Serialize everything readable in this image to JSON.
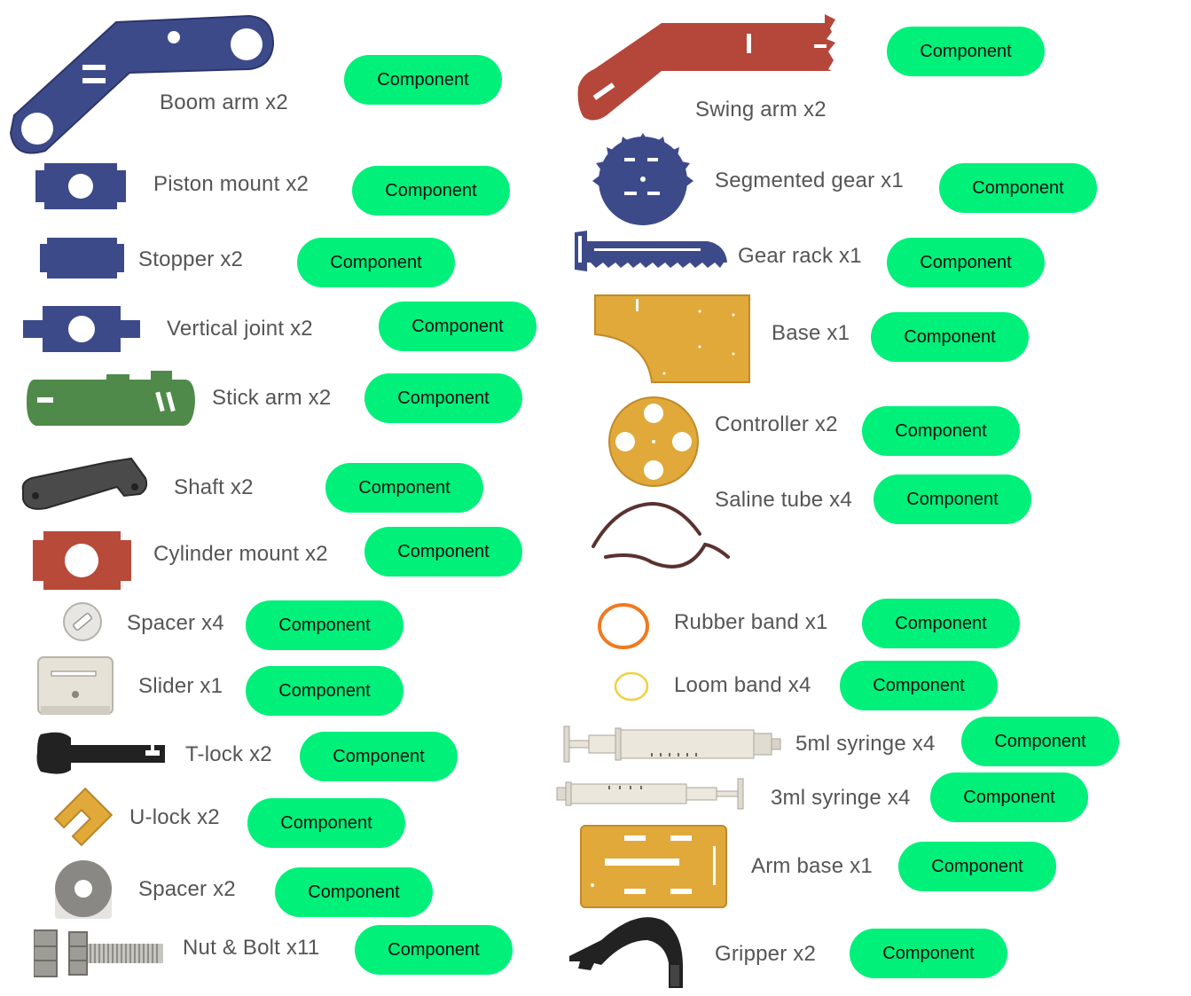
{
  "button_color": "#00f07a",
  "parts": [
    {
      "id": "boom-arm",
      "label": "Boom arm  x2",
      "button": "Component",
      "icon": "boom-arm-icon",
      "color": "#3d4a8a"
    },
    {
      "id": "piston-mount",
      "label": "Piston mount  x2",
      "button": "Component",
      "icon": "piston-mount-icon",
      "color": "#3d4a8a"
    },
    {
      "id": "stopper",
      "label": "Stopper  x2",
      "button": "Component",
      "icon": "stopper-icon",
      "color": "#3d4a8a"
    },
    {
      "id": "vertical-joint",
      "label": "Vertical joint  x2",
      "button": "Component",
      "icon": "vertical-joint-icon",
      "color": "#3d4a8a"
    },
    {
      "id": "stick-arm",
      "label": "Stick arm x2",
      "button": "Component",
      "icon": "stick-arm-icon",
      "color": "#4f8a4a"
    },
    {
      "id": "shaft",
      "label": "Shaft x2",
      "button": "Component",
      "icon": "shaft-icon",
      "color": "#4a4a4a"
    },
    {
      "id": "cylinder-mount",
      "label": "Cylinder mount  x2",
      "button": "Component",
      "icon": "cylinder-mount-icon",
      "color": "#b84a3a"
    },
    {
      "id": "spacer-small",
      "label": "Spacer x4",
      "button": "Component",
      "icon": "spacer-washer-icon",
      "color": "#e2e2e2"
    },
    {
      "id": "slider",
      "label": "Slider x1",
      "button": "Component",
      "icon": "slider-icon",
      "color": "#e6e2d8"
    },
    {
      "id": "t-lock",
      "label": "T-lock  x2",
      "button": "Component",
      "icon": "t-lock-icon",
      "color": "#222222"
    },
    {
      "id": "u-lock",
      "label": "U-lock  x2",
      "button": "Component",
      "icon": "u-lock-icon",
      "color": "#e0a93a"
    },
    {
      "id": "spacer-large",
      "label": "Spacer  x2",
      "button": "Component",
      "icon": "spacer-large-icon",
      "color": "#888888"
    },
    {
      "id": "nut-bolt",
      "label": "Nut & Bolt  x11",
      "button": "Component",
      "icon": "nut-bolt-icon",
      "color": "#999999"
    },
    {
      "id": "swing-arm",
      "label": "Swing arm  x2",
      "button": "Component",
      "icon": "swing-arm-icon",
      "color": "#b84a3a"
    },
    {
      "id": "segmented-gear",
      "label": "Segmented gear x1",
      "button": "Component",
      "icon": "segmented-gear-icon",
      "color": "#3d4a8a"
    },
    {
      "id": "gear-rack",
      "label": "Gear rack x1",
      "button": "Component",
      "icon": "gear-rack-icon",
      "color": "#3d4a8a"
    },
    {
      "id": "base",
      "label": "Base x1",
      "button": "Component",
      "icon": "base-plate-icon",
      "color": "#e0a93a"
    },
    {
      "id": "controller",
      "label": "Controller x2",
      "button": "Component",
      "icon": "controller-disc-icon",
      "color": "#e0a93a"
    },
    {
      "id": "saline-tube",
      "label": "Saline tube x4",
      "button": "Component",
      "icon": "saline-tube-icon",
      "color": "#5a3230"
    },
    {
      "id": "rubber-band",
      "label": "Rubber band x1",
      "button": "Component",
      "icon": "rubber-band-icon",
      "color": "#f07a20"
    },
    {
      "id": "loom-band",
      "label": "Loom band x4",
      "button": "Component",
      "icon": "loom-band-icon",
      "color": "#f2d040"
    },
    {
      "id": "syringe-5ml",
      "label": "5ml syringe x4",
      "button": "Component",
      "icon": "syringe-5ml-icon",
      "color": "#e8e4da"
    },
    {
      "id": "syringe-3ml",
      "label": "3ml syringe x4",
      "button": "Component",
      "icon": "syringe-3ml-icon",
      "color": "#e8e4da"
    },
    {
      "id": "arm-base",
      "label": "Arm base x1",
      "button": "Component",
      "icon": "arm-base-icon",
      "color": "#e0a93a"
    },
    {
      "id": "gripper",
      "label": "Gripper x2",
      "button": "Component",
      "icon": "gripper-icon",
      "color": "#222222"
    }
  ]
}
